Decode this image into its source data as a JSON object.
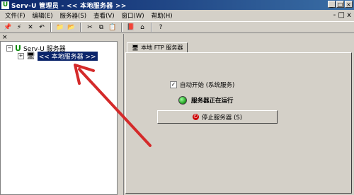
{
  "window": {
    "title": "Serv-U 管理员 - << 本地服务器 >>",
    "app_icon": "serv-u-icon",
    "controls": [
      "minimize",
      "maximize",
      "close"
    ]
  },
  "menu": {
    "items": [
      "文件(F)",
      "编辑(E)",
      "服务器(S)",
      "查看(V)",
      "窗口(W)",
      "帮助(H)"
    ],
    "mdi_controls": "- □ x"
  },
  "toolbar": {
    "icons": [
      "pin-icon",
      "flash-icon",
      "delete-icon",
      "undo-icon",
      "folder-up-icon",
      "folder-refresh-icon",
      "cut-icon",
      "copy-icon",
      "paste-icon",
      "book-icon",
      "home-icon",
      "help-icon"
    ]
  },
  "tree": {
    "close_glyph": "×",
    "root": {
      "expander": "−",
      "label": "Serv-U 服务器"
    },
    "child": {
      "expander": "+",
      "label": "<< 本地服务器 >>"
    }
  },
  "panel": {
    "tab_label": "本地 FTP 服务器",
    "autostart_checked": true,
    "autostart_label": "自动开始 (系统服务)",
    "status_label": "服务器正在运行",
    "stop_button_label": "停止服务器 (S)"
  },
  "annotation": {
    "arrow_color": "#d42a2a"
  }
}
